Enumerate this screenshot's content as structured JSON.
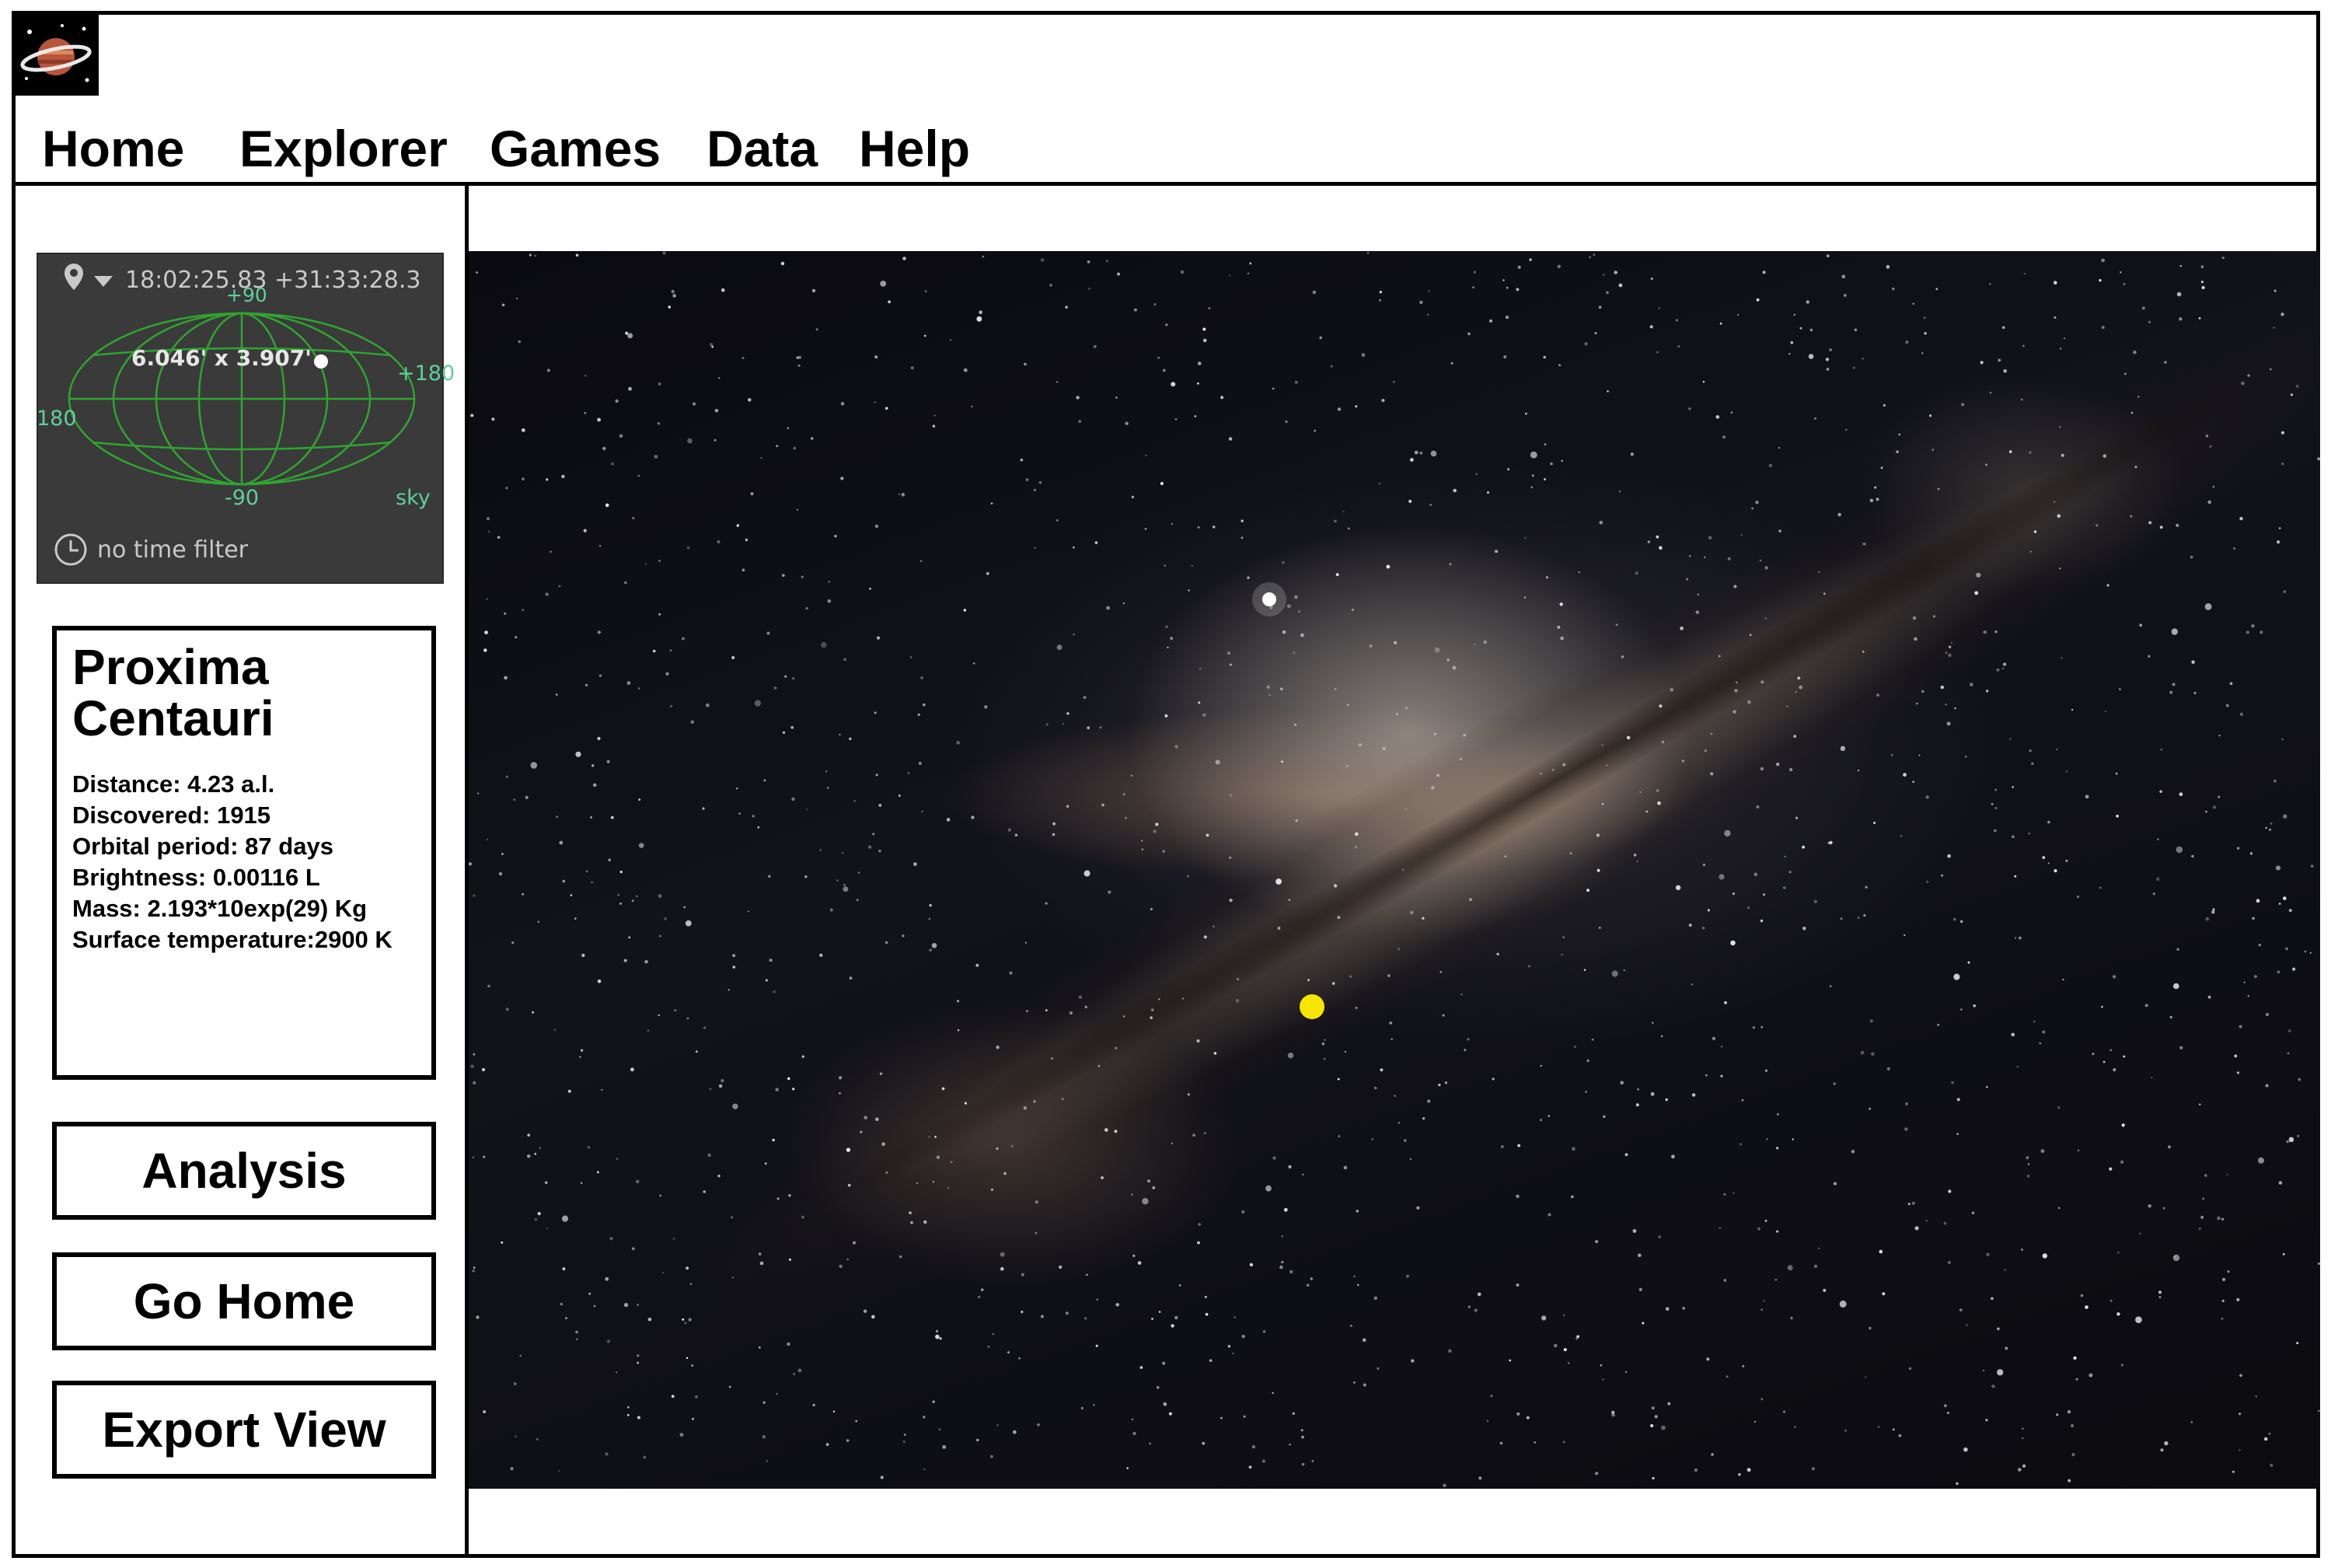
{
  "nav": {
    "items": [
      "Home",
      "Explorer",
      "Games",
      "Data",
      "Help"
    ]
  },
  "skymap": {
    "coords": "18:02:25.83 +31:33:28.3",
    "fov": "6.046' x 3.907'",
    "labels": {
      "top": "+90",
      "bottom": "-90",
      "left": "180",
      "right": "+180",
      "projection": "sky"
    },
    "time_filter": "no time filter",
    "colors": {
      "grid": "#2fa52f",
      "label": "#5ecf9a",
      "background": "#3a3a3a"
    }
  },
  "object": {
    "title_line1": "Proxima",
    "title_line2": "Centauri",
    "details": [
      "Distance: 4.23 a.l.",
      "Discovered: 1915",
      "Orbital period: 87 days",
      "Brightness: 0.00116 L",
      "Mass: 2.193*10exp(29) Kg",
      "Surface temperature:2900 K"
    ]
  },
  "buttons": {
    "analysis": "Analysis",
    "go_home": "Go Home",
    "export_view": "Export View"
  },
  "viewer": {
    "marker_color": "#f5e600"
  }
}
